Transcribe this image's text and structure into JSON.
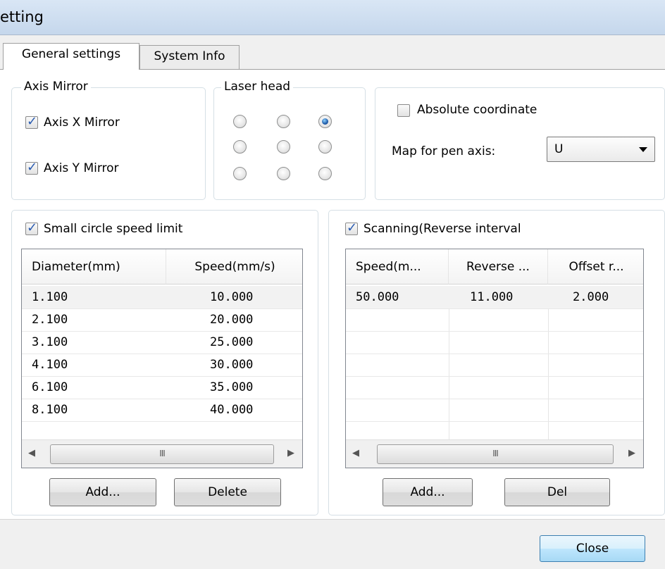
{
  "window": {
    "title": "etting"
  },
  "tabs": [
    {
      "label": "General settings"
    },
    {
      "label": "System Info"
    }
  ],
  "axis_mirror": {
    "legend": "Axis Mirror",
    "x_label": "Axis X Mirror",
    "x_checked": true,
    "y_label": "Axis Y Mirror",
    "y_checked": true
  },
  "laser_head": {
    "legend": "Laser head",
    "selected_index": 2
  },
  "coords": {
    "absolute_label": "Absolute coordinate",
    "absolute_checked": false,
    "map_label": "Map for pen axis:",
    "map_value": "U"
  },
  "small_circle": {
    "checkbox_label": "Small circle speed limit",
    "checked": true,
    "columns": [
      "Diameter(mm)",
      "Speed(mm/s)"
    ],
    "rows": [
      [
        "1.100",
        "10.000"
      ],
      [
        "2.100",
        "20.000"
      ],
      [
        "3.100",
        "25.000"
      ],
      [
        "4.100",
        "30.000"
      ],
      [
        "6.100",
        "35.000"
      ],
      [
        "8.100",
        "40.000"
      ]
    ],
    "add_label": "Add...",
    "delete_label": "Delete"
  },
  "scanning": {
    "checkbox_label": "Scanning(Reverse interval",
    "checked": true,
    "columns": [
      "Speed(m...",
      "Reverse ...",
      "Offset r..."
    ],
    "rows": [
      [
        "50.000",
        "11.000",
        "2.000"
      ]
    ],
    "add_label": "Add...",
    "del_label": "Del"
  },
  "scrollbar": {
    "grip": "III",
    "left_arrow": "◀",
    "right_arrow": "▶"
  },
  "footer": {
    "close_label": "Close"
  }
}
